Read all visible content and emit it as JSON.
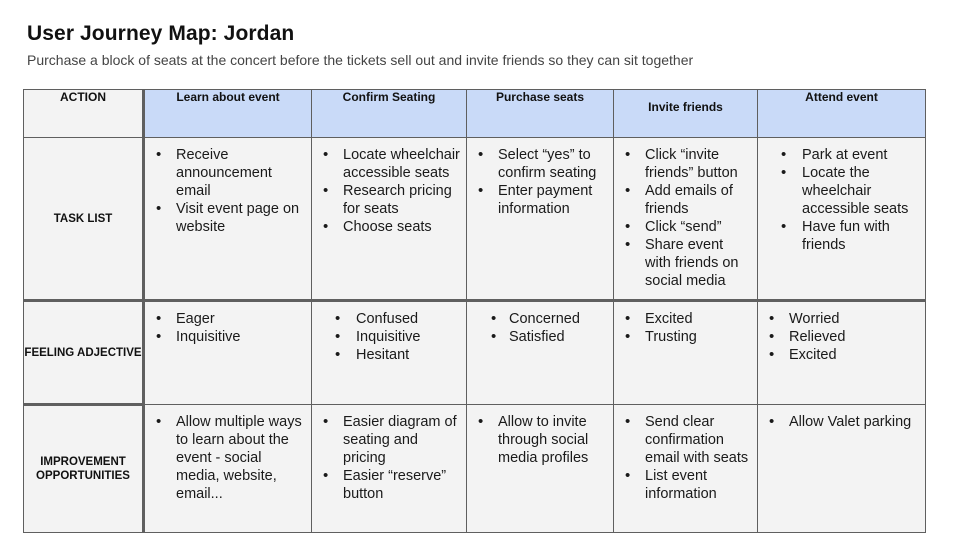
{
  "header": {
    "title": "User Journey Map: Jordan",
    "subtitle": "Purchase a block of seats at the concert before the tickets sell out and invite friends so they can sit together"
  },
  "table": {
    "corner_label": "ACTION",
    "stages": [
      "Learn about event",
      "Confirm Seating",
      "Purchase seats",
      "Invite friends",
      "Attend event"
    ],
    "colors": {
      "stage_header_bg": "#c9daf8",
      "cell_bg": "#f3f3f3",
      "border": "#5f5f5f"
    },
    "rows": [
      {
        "label": "TASK LIST",
        "cells": [
          [
            "Receive announcement email",
            "Visit event page on website"
          ],
          [
            "Locate wheelchair accessible seats",
            "Research pricing for seats",
            "Choose seats"
          ],
          [
            "Select “yes” to confirm seating",
            "Enter payment information"
          ],
          [
            "Click “invite friends” button",
            "Add emails of friends",
            "Click “send”",
            "Share event with friends on social media"
          ],
          [
            "Park at event",
            "Locate the wheelchair accessible seats",
            "Have fun with friends"
          ]
        ]
      },
      {
        "label": "FEELING ADJECTIVE",
        "cells": [
          [
            "Eager",
            "Inquisitive"
          ],
          [
            "Confused",
            "Inquisitive",
            "Hesitant"
          ],
          [
            "Concerned",
            "Satisfied"
          ],
          [
            "Excited",
            "Trusting"
          ],
          [
            "Worried",
            "Relieved",
            "Excited"
          ]
        ]
      },
      {
        "label": "IMPROVEMENT OPPORTUNITIES",
        "cells": [
          [
            "Allow multiple ways to learn about the event - social media, website, email..."
          ],
          [
            "Easier diagram of seating and pricing",
            "Easier “reserve” button"
          ],
          [
            "Allow to invite through social media profiles"
          ],
          [
            "Send clear confirmation email with seats",
            "List event information"
          ],
          [
            "Allow Valet parking"
          ]
        ]
      }
    ]
  }
}
